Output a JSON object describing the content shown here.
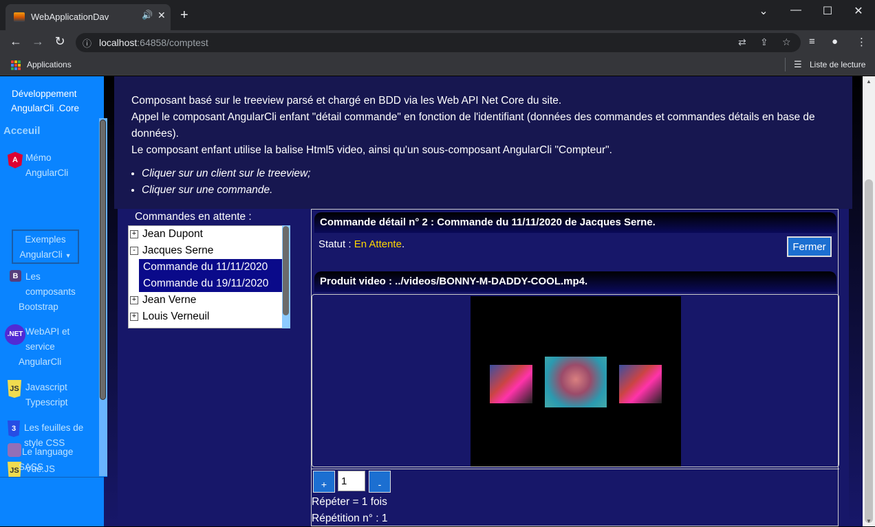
{
  "browser": {
    "tab_title": "WebApplicationDav",
    "url_host": "localhost",
    "url_rest": ":64858/comptest",
    "bookmarks": {
      "apps": "Applications",
      "reading_list": "Liste de lecture"
    }
  },
  "sidebar": {
    "brand_line1": "Développement",
    "brand_line2": "AngularCli .Core",
    "home": "Acceuil",
    "items": [
      {
        "icon": "angular-icon",
        "line1": "Mémo",
        "line2": "AngularCli"
      },
      {
        "icon": "bootstrap-icon",
        "line1": "Les",
        "line2": "composants",
        "line3": "Bootstrap"
      },
      {
        "icon": "dotnet-icon",
        "line1": "WebAPI et",
        "line2": "service",
        "line3": "AngularCli"
      },
      {
        "icon": "javascript-icon",
        "line1": "Javascript",
        "line2": "Typescript"
      },
      {
        "icon": "css-icon",
        "line1": "Les feuilles de",
        "line2": "style CSS"
      },
      {
        "icon": "vuejs-icon",
        "line1": "Vue.JS"
      },
      {
        "icon": "sass-icon",
        "line1": "Le language",
        "line2": "SASS"
      }
    ],
    "active_dropdown": {
      "line1": "Exemples",
      "line2": "AngularCli"
    }
  },
  "intro": {
    "p1": "Composant basé sur le treeview parsé et chargé en BDD via les Web API Net Core du site.",
    "p2": "Appel le composant AngularCli enfant \"détail commande\" en fonction de l'identifiant (données des commandes et commandes détails en base de données).",
    "p3": "Le composant enfant utilise la balise Html5 video, ainsi qu'un sous-composant AngularCli \"Compteur\".",
    "bullets": [
      "Cliquer sur un client sur le treeview;",
      "Cliquer sur une commande."
    ]
  },
  "tree": {
    "label": "Commandes en attente :",
    "clients": [
      {
        "name": "Jean Dupont",
        "toggle": "+"
      },
      {
        "name": "Jacques Serne",
        "toggle": "-",
        "orders": [
          "Commande du 11/11/2020",
          "Commande du 19/11/2020"
        ]
      },
      {
        "name": "Jean Verne",
        "toggle": "+"
      },
      {
        "name": "Louis Verneuil",
        "toggle": "+"
      }
    ]
  },
  "detail": {
    "title": "Commande détail n° 2 : Commande du 11/11/2020 de Jacques Serne.",
    "status_label": "Statut : ",
    "status_value": "En Attente",
    "status_suffix": ".",
    "close_label": "Fermer",
    "product_title": "Produit video : ../videos/BONNY-M-DADDY-COOL.mp4."
  },
  "counter": {
    "plus": "+",
    "minus": "-",
    "value": "1",
    "repeat_text": "Répéter = 1 fois",
    "repetition_text": "Répétition n° : 1"
  }
}
